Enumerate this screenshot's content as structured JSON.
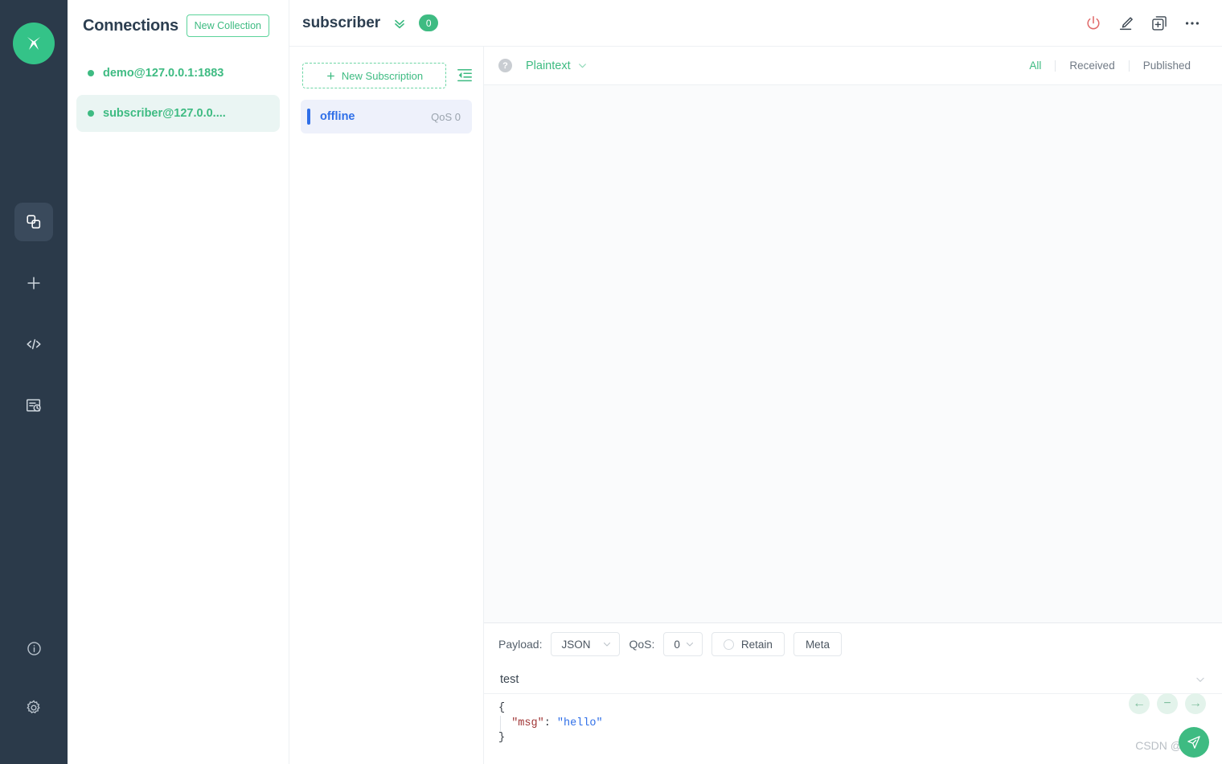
{
  "rail": {
    "logo_name": "mqttx-logo",
    "items": [
      {
        "name": "connections-icon",
        "active": true
      },
      {
        "name": "new-connection-icon",
        "active": false
      },
      {
        "name": "code-icon",
        "active": false
      },
      {
        "name": "log-history-icon",
        "active": false
      }
    ],
    "bottom_items": [
      {
        "name": "info-icon"
      },
      {
        "name": "settings-gear-icon"
      }
    ]
  },
  "connections": {
    "title": "Connections",
    "new_collection_label": "New Collection",
    "items": [
      {
        "name": "demo@127.0.0.1:1883",
        "status": "connected",
        "selected": false
      },
      {
        "name": "subscriber@127.0.0....",
        "status": "connected",
        "selected": true
      }
    ]
  },
  "topbar": {
    "title": "subscriber",
    "badge_count": "0",
    "actions": [
      {
        "name": "disconnect-power-icon"
      },
      {
        "name": "edit-pencil-icon"
      },
      {
        "name": "new-window-icon"
      },
      {
        "name": "more-options-icon"
      }
    ]
  },
  "subscriptions": {
    "new_subscription_label": "New Subscription",
    "collapse_icon": "collapse-panel-icon",
    "items": [
      {
        "topic": "offline",
        "qos": "QoS 0"
      }
    ]
  },
  "messages": {
    "help_glyph": "?",
    "format": "Plaintext",
    "filters": [
      {
        "label": "All",
        "active": true
      },
      {
        "label": "Received",
        "active": false
      },
      {
        "label": "Published",
        "active": false
      }
    ],
    "list": []
  },
  "publish": {
    "payload_label": "Payload:",
    "payload_value": "JSON",
    "qos_label": "QoS:",
    "qos_value": "0",
    "retain_label": "Retain",
    "retain_checked": false,
    "meta_label": "Meta",
    "topic": "test",
    "editor_lines": [
      "{",
      "  \"msg\": \"hello\"",
      "}"
    ],
    "editor_tokens": {
      "open_brace": "{",
      "key": "\"msg\"",
      "colon": ": ",
      "value": "\"hello\"",
      "close_brace": "}"
    },
    "nav_buttons": [
      {
        "name": "prev-message-icon",
        "glyph": "←"
      },
      {
        "name": "clear-message-icon",
        "glyph": "−"
      },
      {
        "name": "next-message-icon",
        "glyph": "→"
      }
    ],
    "send_icon": "send-paperplane-icon"
  },
  "watermark": "CSDN @闻道",
  "colors": {
    "brand_green": "#3ebb82",
    "rail_bg": "#2b3a4a",
    "sub_blue": "#2f6fe8",
    "power_red": "#e06b6b"
  }
}
